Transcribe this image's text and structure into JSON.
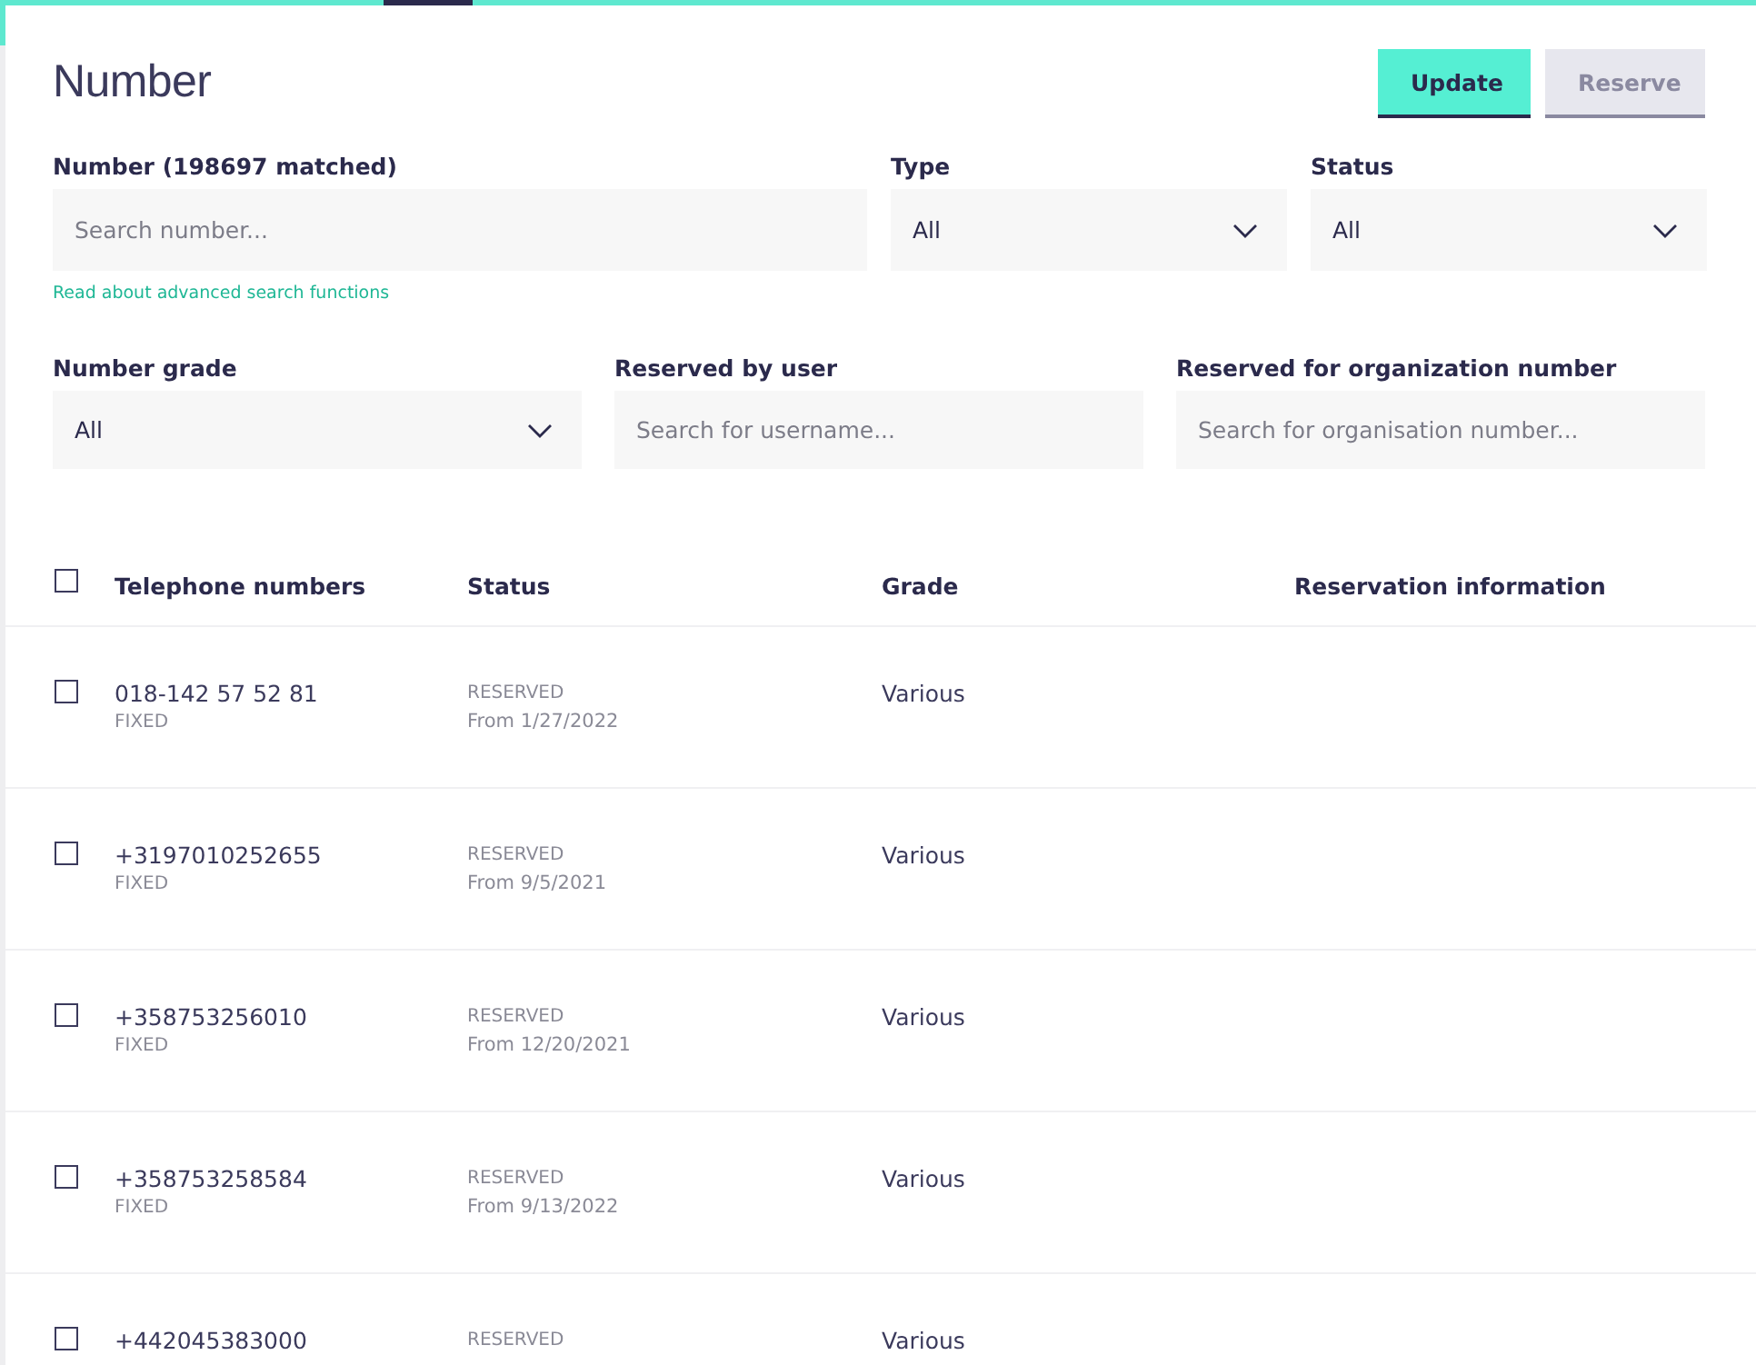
{
  "page": {
    "title": "Number"
  },
  "buttons": [
    {
      "label": "Update",
      "disabled": false
    },
    {
      "label": "Reserve",
      "disabled": true
    }
  ],
  "filters": [
    {
      "kind": "search",
      "label": "Number (198697 matched)",
      "placeholder": "Search number...",
      "help_link": "Read about advanced search functions"
    },
    {
      "kind": "select",
      "label": "Type",
      "value": "All"
    },
    {
      "kind": "select",
      "label": "Status",
      "value": "All"
    },
    {
      "kind": "select",
      "label": "Number grade",
      "value": "All"
    },
    {
      "kind": "search",
      "label": "Reserved by user",
      "placeholder": "Search for username..."
    },
    {
      "kind": "search",
      "label": "Reserved for organization number",
      "placeholder": "Search for organisation number..."
    }
  ],
  "table": {
    "select_all": {
      "checked": false
    },
    "columns": [
      "Telephone numbers",
      "Status",
      "Grade",
      "Reservation information"
    ],
    "rows": [
      {
        "checked": false,
        "number": "018-142 57 52 81",
        "type": "FIXED",
        "status": "RESERVED",
        "since": "From 1/27/2022",
        "grade": "Various"
      },
      {
        "checked": false,
        "number": "+3197010252655",
        "type": "FIXED",
        "status": "RESERVED",
        "since": "From 9/5/2021",
        "grade": "Various"
      },
      {
        "checked": false,
        "number": "+358753256010",
        "type": "FIXED",
        "status": "RESERVED",
        "since": "From 12/20/2021",
        "grade": "Various"
      },
      {
        "checked": false,
        "number": "+358753258584",
        "type": "FIXED",
        "status": "RESERVED",
        "since": "From 9/13/2022",
        "grade": "Various"
      },
      {
        "checked": false,
        "number": "+442045383000",
        "status": "RESERVED",
        "grade": "Various"
      }
    ]
  }
}
